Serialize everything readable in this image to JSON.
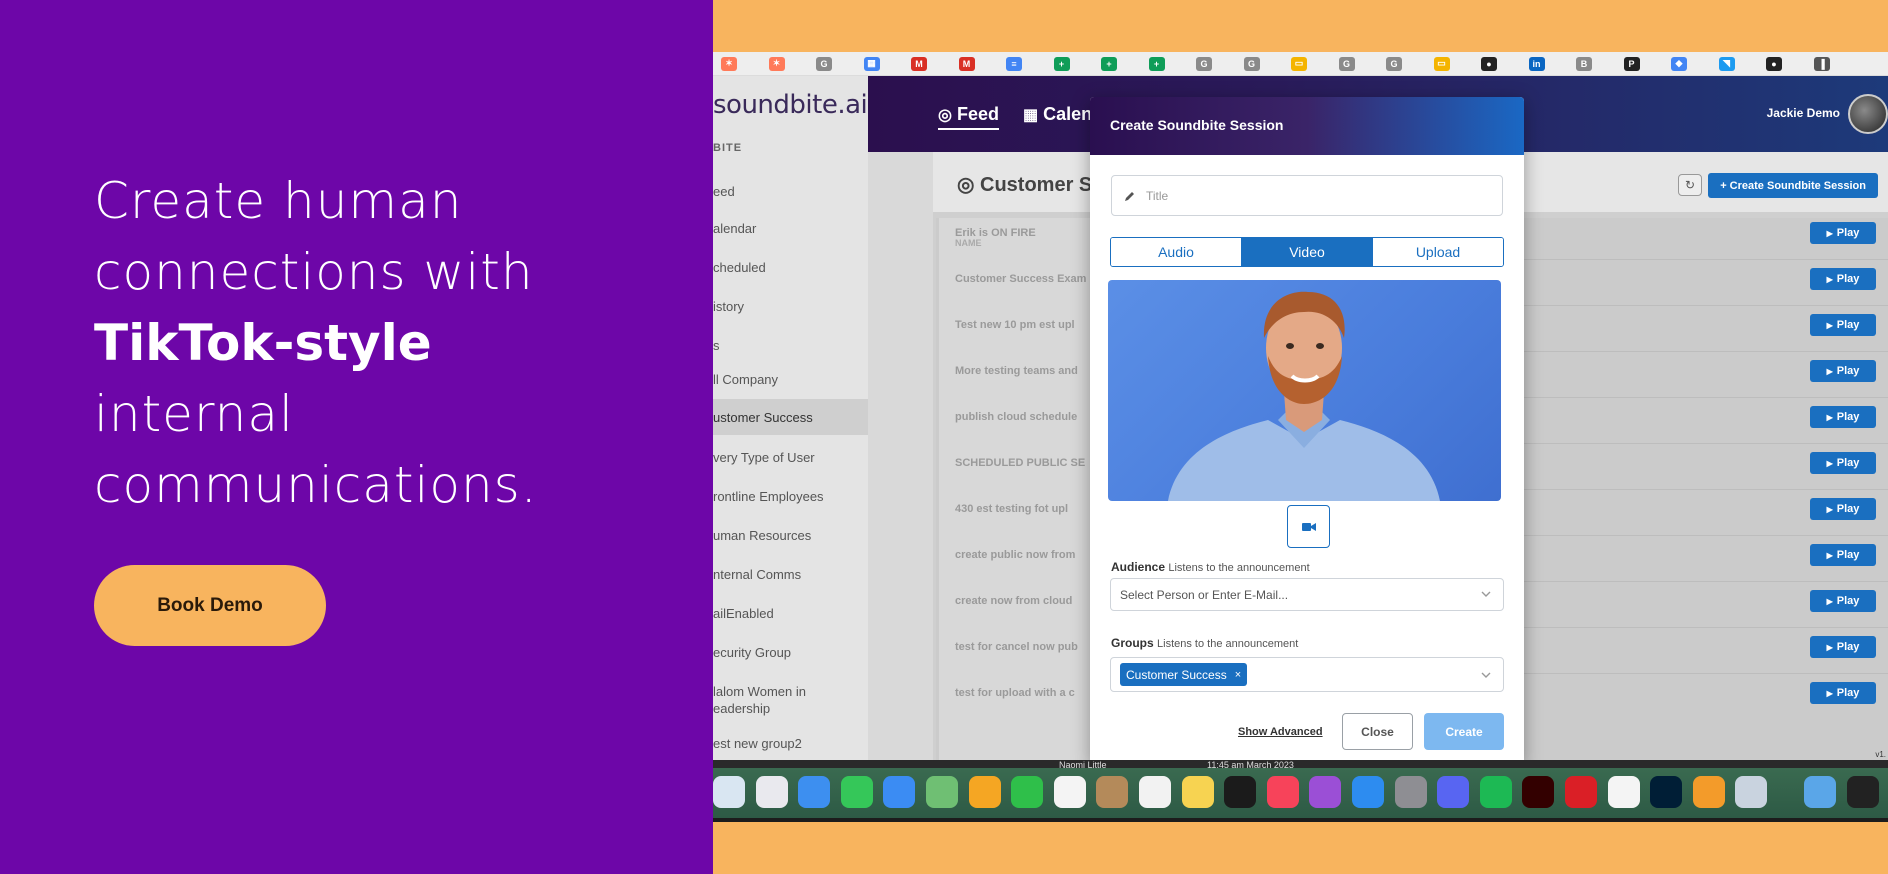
{
  "hero": {
    "line1": "Create human",
    "line2": "connections with",
    "line3": "TikTok-style",
    "line4": "internal",
    "line5": "communications.",
    "cta_label": "Book Demo"
  },
  "bookmarks": [
    {
      "icon": "hubspot-icon",
      "glyph": "✶",
      "color": "#ff7a59"
    },
    {
      "icon": "hubspot-icon",
      "glyph": "✶",
      "color": "#ff7a59"
    },
    {
      "icon": "generic-g-icon",
      "glyph": "G",
      "color": "#8a8a8a"
    },
    {
      "icon": "calendar-icon",
      "glyph": "▦",
      "color": "#4285f4"
    },
    {
      "icon": "gmail-icon",
      "glyph": "M",
      "color": "#d93025"
    },
    {
      "icon": "gmail-icon",
      "glyph": "M",
      "color": "#d93025"
    },
    {
      "icon": "docs-icon",
      "glyph": "≡",
      "color": "#4285f4"
    },
    {
      "icon": "sheets-icon",
      "glyph": "+",
      "color": "#0f9d58"
    },
    {
      "icon": "sheets-icon",
      "glyph": "+",
      "color": "#0f9d58"
    },
    {
      "icon": "sheets-icon",
      "glyph": "+",
      "color": "#0f9d58"
    },
    {
      "icon": "generic-g-icon",
      "glyph": "G",
      "color": "#8a8a8a"
    },
    {
      "icon": "generic-g-icon",
      "glyph": "G",
      "color": "#8a8a8a"
    },
    {
      "icon": "slides-icon",
      "glyph": "▭",
      "color": "#f4b400"
    },
    {
      "icon": "generic-g-icon",
      "glyph": "G",
      "color": "#8a8a8a"
    },
    {
      "icon": "generic-g-icon",
      "glyph": "G",
      "color": "#8a8a8a"
    },
    {
      "icon": "slides-icon",
      "glyph": "▭",
      "color": "#f4b400"
    },
    {
      "icon": "github-icon",
      "glyph": "●",
      "color": "#222222"
    },
    {
      "icon": "linkedin-icon",
      "glyph": "in",
      "color": "#0a66c2"
    },
    {
      "icon": "generic-b-icon",
      "glyph": "B",
      "color": "#8a8a8a"
    },
    {
      "icon": "p-icon",
      "glyph": "P",
      "color": "#222222"
    },
    {
      "icon": "translate-icon",
      "glyph": "◆",
      "color": "#4285f4"
    },
    {
      "icon": "twitter-icon",
      "glyph": "◥",
      "color": "#1d9bf0"
    },
    {
      "icon": "github-icon",
      "glyph": "●",
      "color": "#222222"
    },
    {
      "icon": "bookmark-icon",
      "glyph": "▐",
      "color": "#555555"
    }
  ],
  "app": {
    "logo": "soundbite.ai",
    "section_label": "BITE",
    "sidebar_items": [
      "eed",
      "alendar",
      "cheduled",
      "istory",
      "s",
      "ll Company",
      "ustomer Success",
      "very Type of User",
      "rontline Employees",
      "uman Resources",
      "nternal Comms",
      "ailEnabled",
      "ecurity Group",
      "lalom Women in",
      "eadership",
      "est new group2"
    ],
    "active_sidebar_index": 6,
    "nav_feed": "Feed",
    "nav_calendar": "Calen",
    "user_name": "Jackie Demo",
    "page_title": "Customer S",
    "create_session_button": "+ Create Soundbite Session",
    "column_header": "NAME",
    "rows": [
      "Erik is ON FIRE",
      "Customer Success Exam",
      "Test new 10 pm est upl",
      "More testing teams and",
      "publish cloud schedule",
      "SCHEDULED PUBLIC SE",
      "430 est testing fot upl",
      "create public now from",
      "create now from cloud",
      "test for cancel now pub",
      "test for upload with a c"
    ],
    "play_label": "Play",
    "version": "v1."
  },
  "modal": {
    "title": "Create Soundbite Session",
    "title_placeholder": "Title",
    "tabs": [
      "Audio",
      "Video",
      "Upload"
    ],
    "active_tab": "Video",
    "audience_label": "Audience",
    "audience_hint": "Listens to the announcement",
    "audience_placeholder": "Select Person or Enter E-Mail...",
    "groups_label": "Groups",
    "groups_hint": "Listens to the announcement",
    "group_chip": "Customer Success",
    "show_advanced": "Show Advanced",
    "close": "Close",
    "create": "Create"
  },
  "status_strip": {
    "left": "Naomi Little",
    "right": "11:45 am March 2023"
  },
  "dock_icons": [
    {
      "name": "finder-icon",
      "color": "#d9e6f2"
    },
    {
      "name": "launchpad-icon",
      "color": "#e9e9ee"
    },
    {
      "name": "safari-icon",
      "color": "#3d8ff0"
    },
    {
      "name": "messages-icon",
      "color": "#35c759"
    },
    {
      "name": "mail-icon",
      "color": "#3b8cf3"
    },
    {
      "name": "maps-icon",
      "color": "#6fbf73"
    },
    {
      "name": "photos-icon",
      "color": "#f5a623"
    },
    {
      "name": "facetime-icon",
      "color": "#2fbf4a"
    },
    {
      "name": "calendar-app-icon",
      "color": "#f4f4f4"
    },
    {
      "name": "contacts-icon",
      "color": "#b48a5a"
    },
    {
      "name": "reminders-icon",
      "color": "#f2f2f2"
    },
    {
      "name": "notes-icon",
      "color": "#f7d351"
    },
    {
      "name": "tv-icon",
      "color": "#1b1b1b"
    },
    {
      "name": "music-icon",
      "color": "#f7435a"
    },
    {
      "name": "podcasts-icon",
      "color": "#9b4fd6"
    },
    {
      "name": "app-store-icon",
      "color": "#2d8cf0"
    },
    {
      "name": "system-settings-icon",
      "color": "#8e8e93"
    },
    {
      "name": "discord-icon",
      "color": "#5865f2"
    },
    {
      "name": "spotify-icon",
      "color": "#1db954"
    },
    {
      "name": "illustrator-icon",
      "color": "#330000"
    },
    {
      "name": "creative-cloud-icon",
      "color": "#da1f26"
    },
    {
      "name": "chrome-icon",
      "color": "#f4f4f4"
    },
    {
      "name": "photoshop-icon",
      "color": "#001e36"
    },
    {
      "name": "pages-icon",
      "color": "#f39b2a"
    },
    {
      "name": "preview-icon",
      "color": "#c9d3df"
    },
    {
      "name": "folder-icon",
      "color": "#5aa6e8"
    },
    {
      "name": "screenshot-icon",
      "color": "#222222"
    },
    {
      "name": "keyboard-viewer-icon",
      "color": "#444444"
    }
  ],
  "icons": {
    "avatar": "avatar",
    "pencil": "pencil-icon",
    "video_camera": "video-camera-icon",
    "chevron": "chevron-down-icon",
    "refresh": "refresh-icon",
    "play": "play-icon",
    "podcast": "podcast-icon",
    "calendar_nav": "calendar-icon"
  },
  "colors": {
    "hero_background": "#6d06a8",
    "page_background": "#f8b45e",
    "cta_background": "#f8b45e",
    "primary_blue": "#1a6fc0",
    "create_disabled": "#7db8f0"
  }
}
